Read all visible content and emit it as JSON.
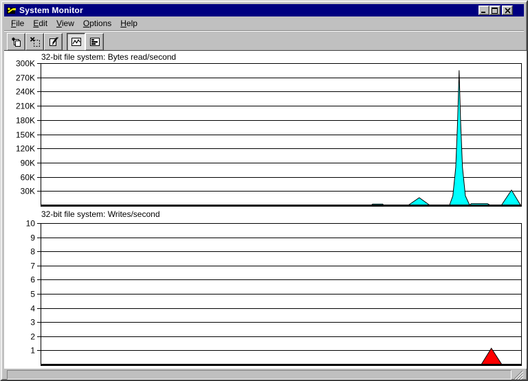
{
  "window": {
    "title": "System Monitor",
    "icon": "system-monitor-icon",
    "controls": [
      {
        "name": "minimize",
        "icon": "minimize-icon"
      },
      {
        "name": "maximize",
        "icon": "maximize-icon"
      },
      {
        "name": "close",
        "icon": "close-icon"
      }
    ]
  },
  "menu": {
    "items": [
      {
        "label": "File",
        "hot": "F",
        "rest": "ile"
      },
      {
        "label": "Edit",
        "hot": "E",
        "rest": "dit"
      },
      {
        "label": "View",
        "hot": "V",
        "rest": "iew"
      },
      {
        "label": "Options",
        "hot": "O",
        "rest": "ptions"
      },
      {
        "label": "Help",
        "hot": "H",
        "rest": "elp"
      }
    ]
  },
  "toolbar": {
    "buttons": [
      {
        "name": "add-item",
        "icon": "add-item-icon",
        "pressed": false
      },
      {
        "name": "remove-item",
        "icon": "remove-item-icon",
        "pressed": false
      },
      {
        "name": "edit-item",
        "icon": "edit-item-icon",
        "pressed": false
      },
      {
        "name": "line-charts-view",
        "icon": "line-chart-icon",
        "pressed": true
      },
      {
        "name": "bar-charts-view",
        "icon": "bar-chart-icon",
        "pressed": false
      }
    ]
  },
  "status_bar": {
    "text": ""
  },
  "colors": {
    "titlebar": "#000080",
    "chrome": "#c0c0c0",
    "plot_background": "#ffffff",
    "grid": "#000000",
    "bytes_read_fill": "#00ffff",
    "writes_fill": "#ff0000"
  },
  "chart_data": [
    {
      "type": "area",
      "title": "32-bit file system: Bytes read/second",
      "xlabel": "",
      "ylabel": "",
      "ylim": [
        0,
        300000
      ],
      "grid": true,
      "legend": "none",
      "y_ticks": [
        {
          "label": "300K",
          "value": 300000
        },
        {
          "label": "270K",
          "value": 270000
        },
        {
          "label": "240K",
          "value": 240000
        },
        {
          "label": "210K",
          "value": 210000
        },
        {
          "label": "180K",
          "value": 180000
        },
        {
          "label": "150K",
          "value": 150000
        },
        {
          "label": "120K",
          "value": 120000
        },
        {
          "label": "90K",
          "value": 90000
        },
        {
          "label": "60K",
          "value": 60000
        },
        {
          "label": "30K",
          "value": 30000
        }
      ],
      "series": [
        {
          "name": "Bytes read/second",
          "color": "#00ffff",
          "points": [
            [
              0.0,
              0
            ],
            [
              0.688,
              0
            ],
            [
              0.691,
              2500
            ],
            [
              0.712,
              2500
            ],
            [
              0.714,
              0
            ],
            [
              0.765,
              0
            ],
            [
              0.788,
              16000
            ],
            [
              0.81,
              0
            ],
            [
              0.851,
              0
            ],
            [
              0.858,
              20000
            ],
            [
              0.864,
              80000
            ],
            [
              0.868,
              180000
            ],
            [
              0.871,
              285000
            ],
            [
              0.874,
              180000
            ],
            [
              0.878,
              80000
            ],
            [
              0.884,
              20000
            ],
            [
              0.893,
              0
            ],
            [
              0.896,
              3500
            ],
            [
              0.93,
              3500
            ],
            [
              0.936,
              0
            ],
            [
              0.959,
              0
            ],
            [
              0.98,
              32000
            ],
            [
              0.999,
              0
            ]
          ]
        }
      ],
      "peak_value": 285000
    },
    {
      "type": "area",
      "title": "32-bit file system: Writes/second",
      "xlabel": "",
      "ylabel": "",
      "ylim": [
        0,
        10
      ],
      "grid": true,
      "legend": "none",
      "y_ticks": [
        {
          "label": "10",
          "value": 10
        },
        {
          "label": "9",
          "value": 9
        },
        {
          "label": "8",
          "value": 8
        },
        {
          "label": "7",
          "value": 7
        },
        {
          "label": "6",
          "value": 6
        },
        {
          "label": "5",
          "value": 5
        },
        {
          "label": "4",
          "value": 4
        },
        {
          "label": "3",
          "value": 3
        },
        {
          "label": "2",
          "value": 2
        },
        {
          "label": "1",
          "value": 1
        }
      ],
      "series": [
        {
          "name": "Writes/second",
          "color": "#ff0000",
          "points": [
            [
              0.0,
              0
            ],
            [
              0.917,
              0
            ],
            [
              0.938,
              1.15
            ],
            [
              0.96,
              0
            ],
            [
              0.999,
              0
            ]
          ]
        }
      ],
      "peak_value": 1.15
    }
  ]
}
